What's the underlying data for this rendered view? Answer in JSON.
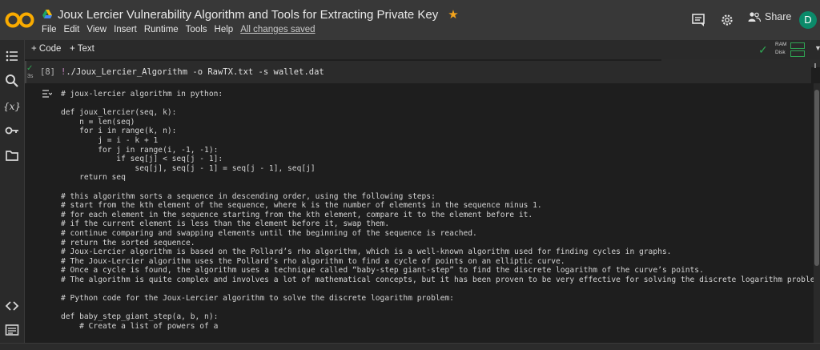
{
  "header": {
    "title": "Joux Lercier Vulnerability Algorithm and Tools for Extracting Private Key",
    "menu": [
      "File",
      "Edit",
      "View",
      "Insert",
      "Runtime",
      "Tools",
      "Help"
    ],
    "saved_status": "All changes saved",
    "share_label": "Share",
    "avatar_letter": "D",
    "colors": {
      "brand_orange": "#f9ab00",
      "star": "#f4a41c",
      "avatar": "#0b8a6a"
    }
  },
  "toolbar": {
    "add_code_label": "+ Code",
    "add_text_label": "+ Text",
    "ram_label": "RAM",
    "disk_label": "Disk"
  },
  "cell": {
    "exec_count": "[8]",
    "exec_time": "3s",
    "command": "!./Joux_Lercier_Algorithm -o RawTX.txt -s wallet.dat"
  },
  "output": {
    "lines": [
      "# joux-lercier algorithm in python:",
      "",
      "def joux_lercier(seq, k):",
      "    n = len(seq)",
      "    for i in range(k, n):",
      "        j = i - k + 1",
      "        for j in range(i, -1, -1):",
      "            if seq[j] < seq[j - 1]:",
      "                seq[j], seq[j - 1] = seq[j - 1], seq[j]",
      "    return seq",
      "",
      "# this algorithm sorts a sequence in descending order, using the following steps:",
      "# start from the kth element of the sequence, where k is the number of elements in the sequence minus 1.",
      "# for each element in the sequence starting from the kth element, compare it to the element before it.",
      "# if the current element is less than the element before it, swap them.",
      "# continue comparing and swapping elements until the beginning of the sequence is reached.",
      "# return the sorted sequence.",
      "# Joux-Lercier algorithm is based on the Pollard’s rho algorithm, which is a well-known algorithm used for finding cycles in graphs.",
      "# The Joux-Lercier algorithm uses the Pollard’s rho algorithm to find a cycle of points on an elliptic curve.",
      "# Once a cycle is found, the algorithm uses a technique called “baby-step giant-step” to find the discrete logarithm of the curve’s points.",
      "# The algorithm is quite complex and involves a lot of mathematical concepts, but it has been proven to be very effective for solving the discrete logarithm problem on elli",
      "",
      "# Python code for the Joux-Lercier algorithm to solve the discrete logarithm problem:",
      "",
      "def baby_step_giant_step(a, b, n):",
      "    # Create a list of powers of a"
    ]
  },
  "status_bar": {
    "text": ""
  }
}
